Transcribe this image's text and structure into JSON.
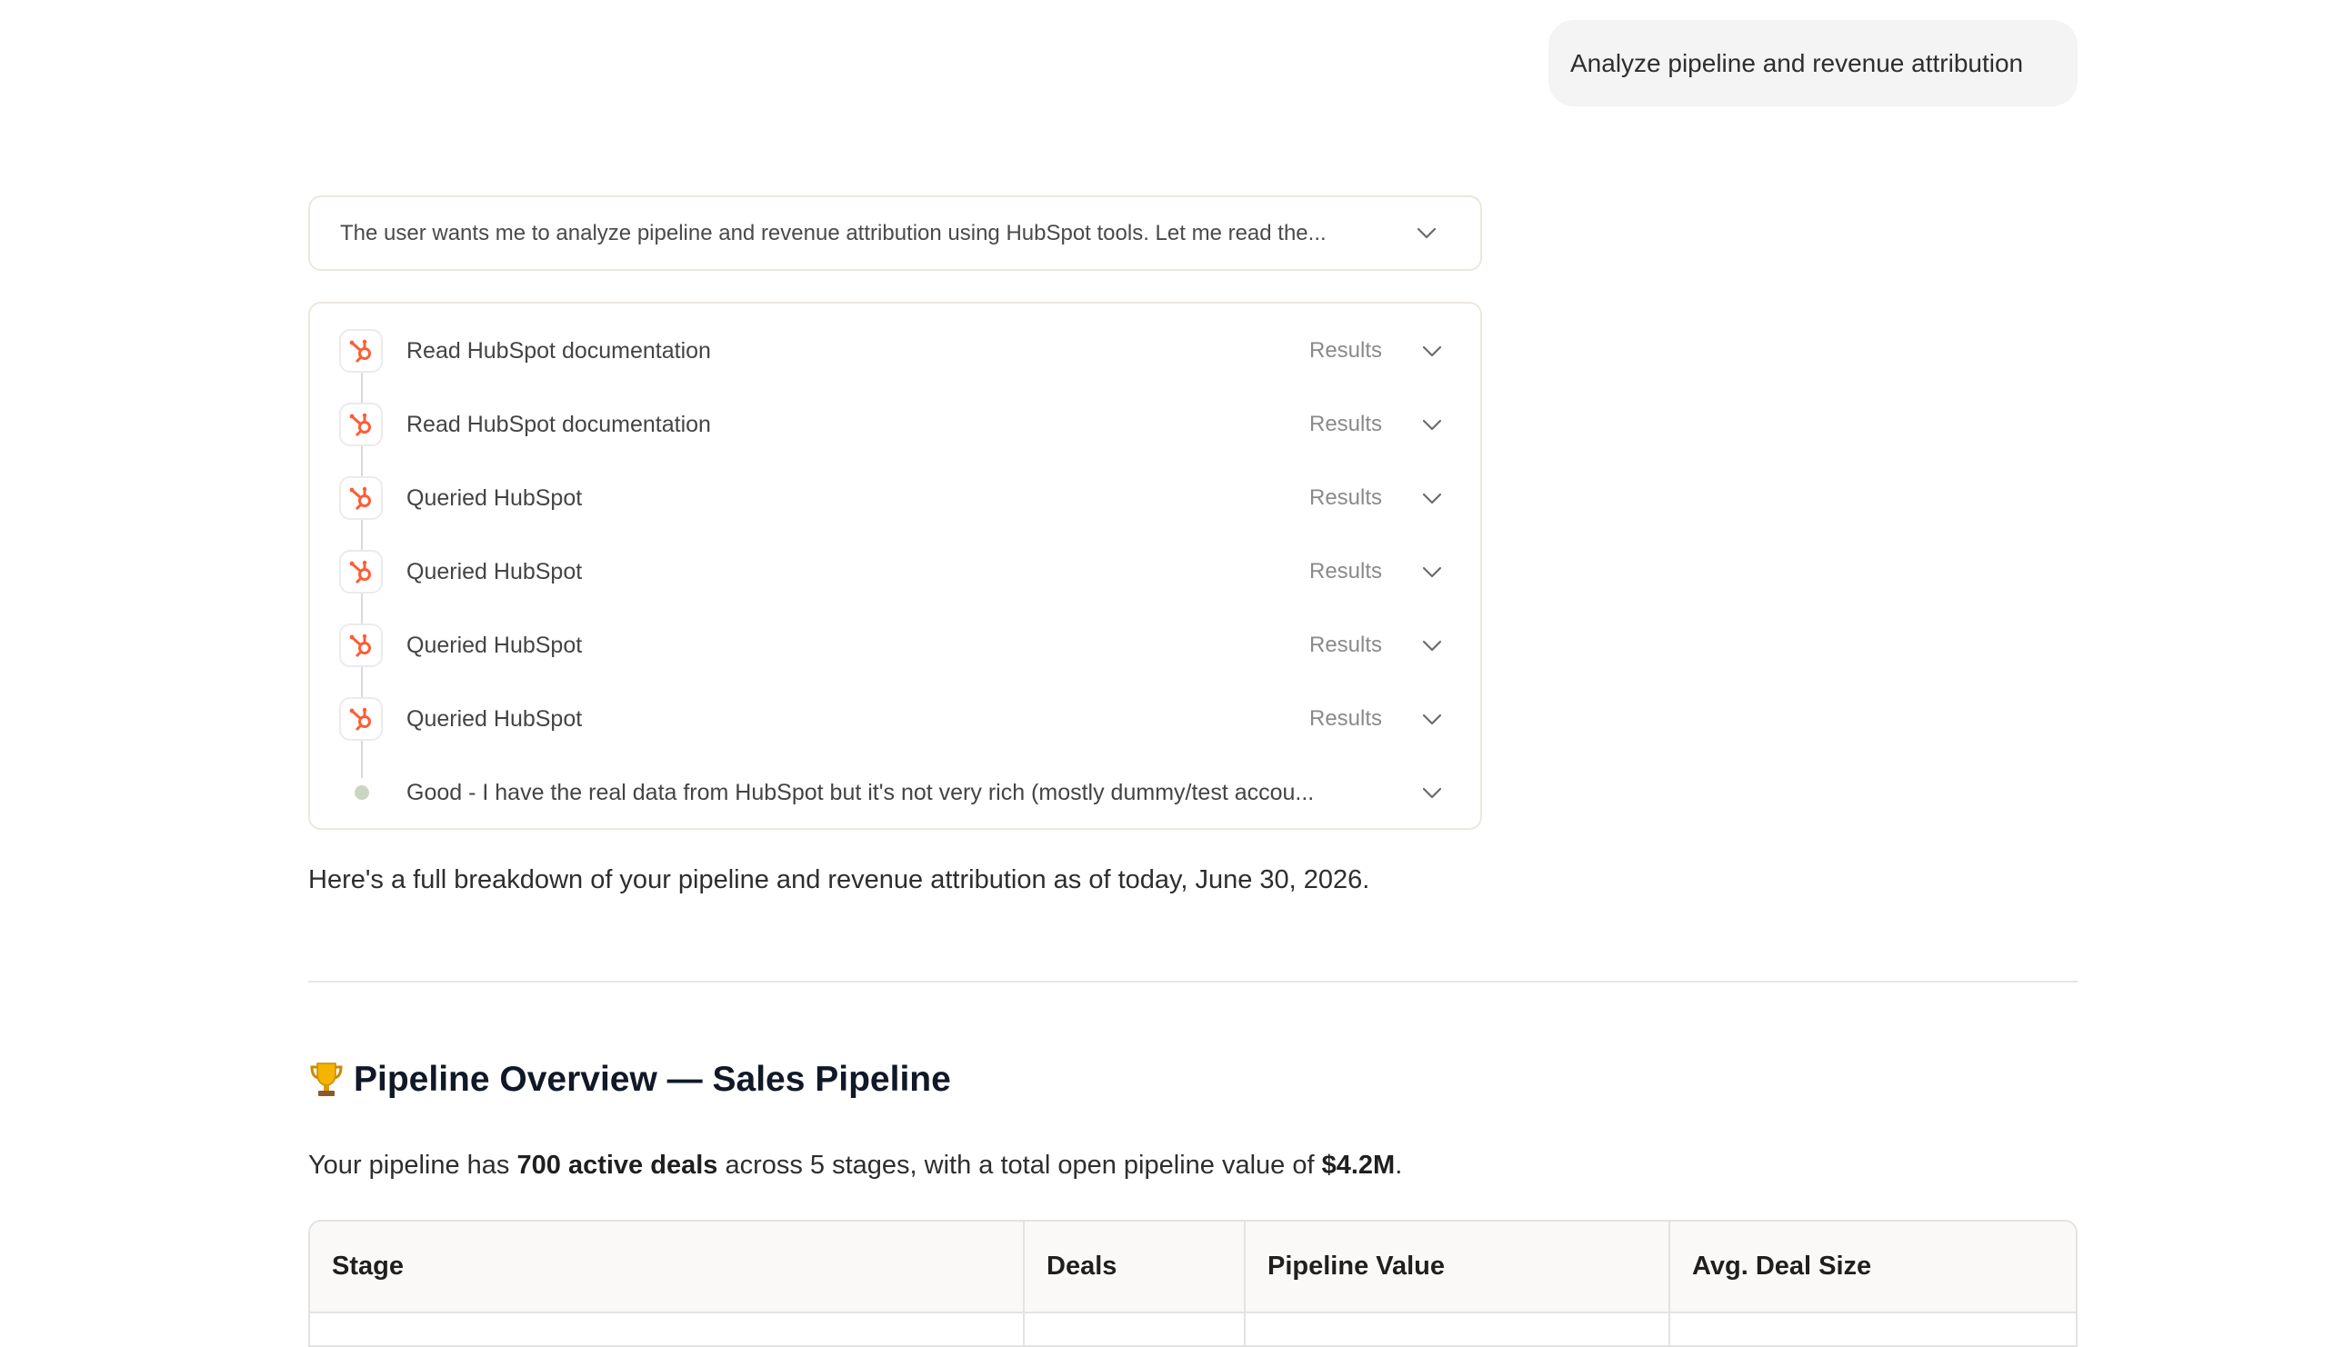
{
  "user_message": "Analyze pipeline and revenue attribution",
  "thought_summary": "The user wants me to analyze pipeline and revenue attribution using HubSpot tools. Let me read the...",
  "steps": [
    {
      "label": "Read HubSpot documentation",
      "results": "Results",
      "icon": "hubspot-icon"
    },
    {
      "label": "Read HubSpot documentation",
      "results": "Results",
      "icon": "hubspot-icon"
    },
    {
      "label": "Queried HubSpot",
      "results": "Results",
      "icon": "hubspot-icon"
    },
    {
      "label": "Queried HubSpot",
      "results": "Results",
      "icon": "hubspot-icon"
    },
    {
      "label": "Queried HubSpot",
      "results": "Results",
      "icon": "hubspot-icon"
    },
    {
      "label": "Queried HubSpot",
      "results": "Results",
      "icon": "hubspot-icon"
    }
  ],
  "final_thought": "Good - I have the real data from HubSpot but it's not very rich (mostly dummy/test accou...",
  "intro": "Here's a full breakdown of your pipeline and revenue attribution as of today, June 30, 2026.",
  "section": {
    "title": "Pipeline Overview — Sales Pipeline",
    "summary_pre": "Your pipeline has ",
    "summary_deals": "700 active deals",
    "summary_mid": " across 5 stages, with a total open pipeline value of ",
    "summary_value": "$4.2M",
    "summary_post": "."
  },
  "table": {
    "headers": [
      "Stage",
      "Deals",
      "Pipeline Value",
      "Avg. Deal Size"
    ]
  },
  "colors": {
    "hubspot_orange": "#ff5c35",
    "timeline_dot": "#cbd6c2",
    "card_border": "#ece8dc"
  }
}
